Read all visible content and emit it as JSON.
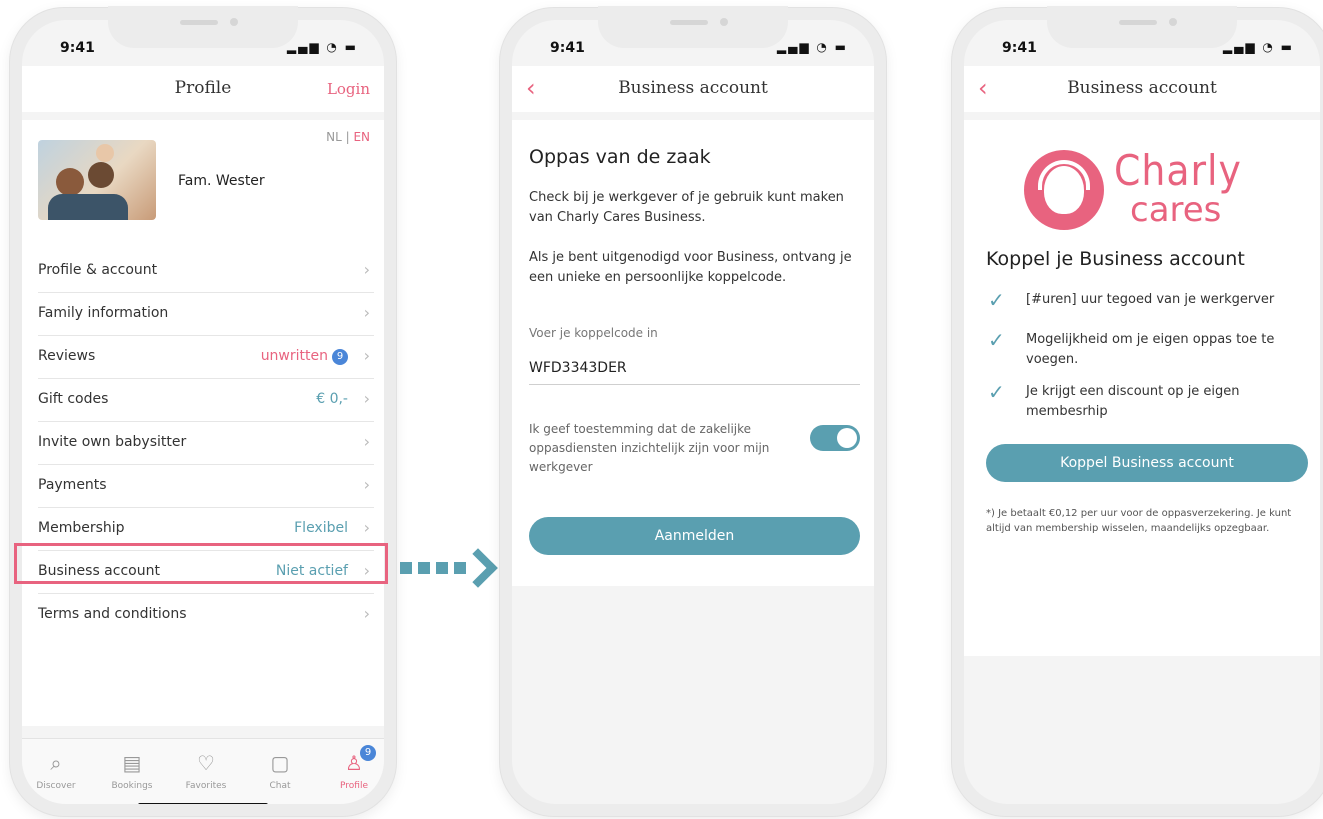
{
  "status": {
    "time": "9:41",
    "icons": "▂▄▆ ◔ ▬"
  },
  "screen1": {
    "title": "Profile",
    "login": "Login",
    "lang_nl": "NL",
    "lang_sep": " | ",
    "lang_en": "EN",
    "family_name": "Fam. Wester",
    "menu": [
      {
        "label": "Profile & account",
        "value": ""
      },
      {
        "label": "Family information",
        "value": ""
      },
      {
        "label": "Reviews",
        "value": "unwritten",
        "badge": "9"
      },
      {
        "label": "Gift codes",
        "value": "€ 0,-"
      },
      {
        "label": "Invite own babysitter",
        "value": ""
      },
      {
        "label": "Payments",
        "value": ""
      },
      {
        "label": "Membership",
        "value": "Flexibel"
      },
      {
        "label": "Business account",
        "value": "Niet actief"
      },
      {
        "label": "Terms and conditions",
        "value": ""
      }
    ],
    "chevron": "›",
    "tabs": [
      {
        "label": "Discover",
        "icon": "⌕"
      },
      {
        "label": "Bookings",
        "icon": "▤"
      },
      {
        "label": "Favorites",
        "icon": "♡"
      },
      {
        "label": "Chat",
        "icon": "▢"
      },
      {
        "label": "Profile",
        "icon": "♙",
        "badge": "9"
      }
    ]
  },
  "screen2": {
    "title": "Business account",
    "back": "‹",
    "heading": "Oppas van de zaak",
    "para1": "Check bij je werkgever of je gebruik kunt maken van Charly Cares Business.",
    "para2": "Als je bent uitgenodigd voor Business, ontvang je een unieke en persoonlijke koppelcode.",
    "field_label": "Voer je koppelcode in",
    "field_value": "WFD3343DER",
    "consent": "Ik geef toestemming dat de zakelijke oppasdiensten inzichtelijk zijn voor mijn werkgever",
    "button": "Aanmelden"
  },
  "screen3": {
    "title": "Business account",
    "back": "‹",
    "logo_line1": "Charly",
    "logo_line2": "cares",
    "heading": "Koppel je Business account",
    "check": "✓",
    "bullets": [
      "[#uren] uur tegoed van je werkgerver",
      "Mogelijkheid om je eigen oppas toe te voegen.",
      "Je krijgt een discount op je eigen membesrhip"
    ],
    "button": "Koppel Business account",
    "fineprint": "*) Je betaalt €0,12 per uur voor de oppasverzekering. Je kunt altijd van membership wisselen, maandelijks opzegbaar."
  },
  "colors": {
    "pink": "#e8637f",
    "teal": "#5a9fb0",
    "badge_blue": "#4a86d8"
  }
}
